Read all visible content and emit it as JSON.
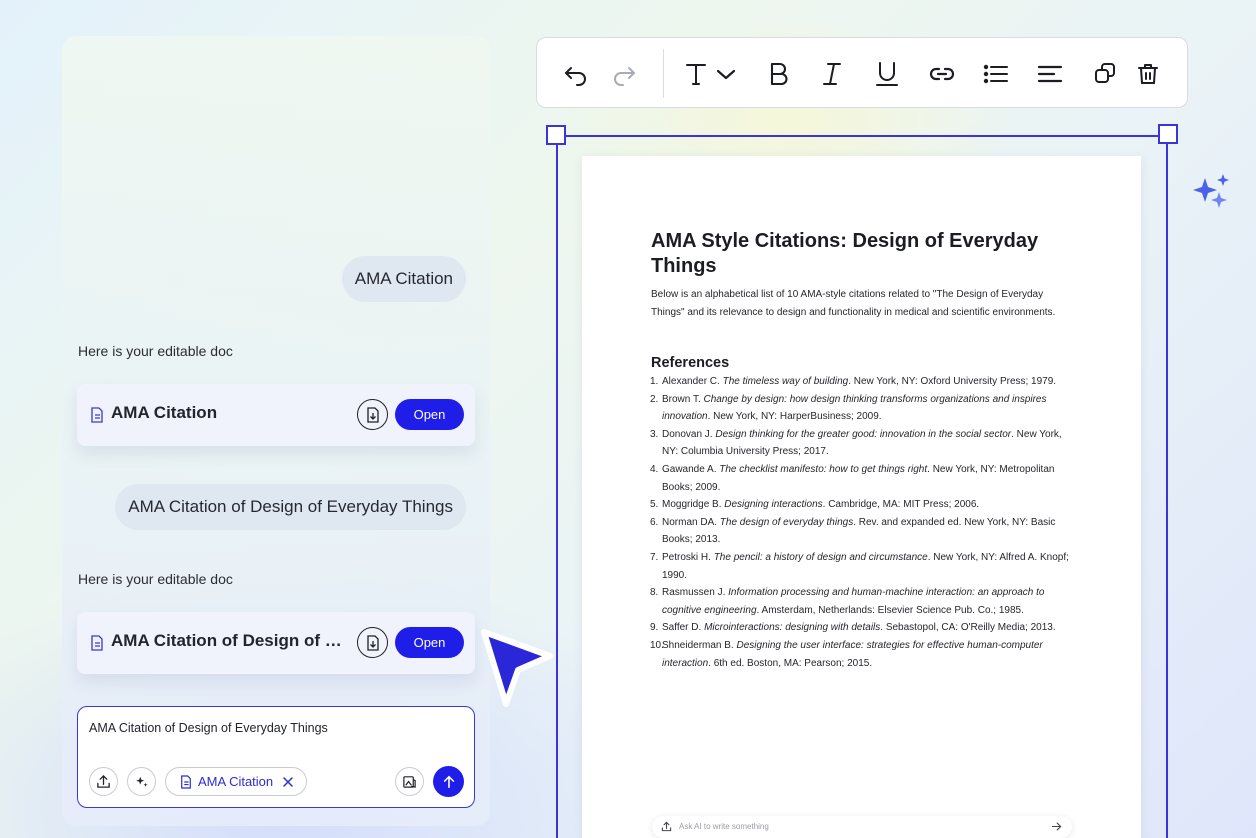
{
  "chat": {
    "user_messages": [
      "AMA Citation",
      "AMA Citation of Design of Everyday Things"
    ],
    "assistant_messages": [
      "Here is your editable doc",
      "Here is your editable doc"
    ],
    "doc_cards": [
      {
        "title": "AMA Citation",
        "open_label": "Open"
      },
      {
        "title": "AMA Citation of Design of Everyday Things",
        "open_label": "Open"
      }
    ],
    "composer": {
      "text": "AMA Citation of Design of Everyday Things",
      "attachment_label": "AMA Citation"
    }
  },
  "toolbar": {
    "icons": [
      "undo-icon",
      "redo-icon",
      "text-style-icon",
      "bold-icon",
      "italic-icon",
      "underline-icon",
      "link-icon",
      "bullet-list-icon",
      "align-icon",
      "duplicate-icon",
      "delete-icon"
    ]
  },
  "document": {
    "title": "AMA Style Citations: Design of Everyday Things",
    "intro": "Below is an alphabetical list of 10 AMA-style citations related to \"The Design of Everyday Things\" and its relevance to design and functionality in medical and scientific environments.",
    "references_heading": "References",
    "references": [
      {
        "num": "1.",
        "author": "Alexander C.",
        "title": "The timeless way of building",
        "rest": ". New York, NY: Oxford University Press; 1979."
      },
      {
        "num": "2.",
        "author": "Brown T.",
        "title": "Change by design: how design thinking transforms organizations and inspires innovation",
        "rest": ". New York, NY: HarperBusiness; 2009."
      },
      {
        "num": "3.",
        "author": "Donovan J.",
        "title": "Design thinking for the greater good: innovation in the social sector",
        "rest": ". New York, NY: Columbia University Press; 2017."
      },
      {
        "num": "4.",
        "author": "Gawande A.",
        "title": "The checklist manifesto: how to get things right",
        "rest": ". New York, NY: Metropolitan Books; 2009."
      },
      {
        "num": "5.",
        "author": "Moggridge B.",
        "title": "Designing interactions",
        "rest": ". Cambridge, MA: MIT Press; 2006."
      },
      {
        "num": "6.",
        "author": "Norman DA.",
        "title": "The design of everyday things",
        "rest": ". Rev. and expanded ed. New York, NY: Basic Books; 2013."
      },
      {
        "num": "7.",
        "author": "Petroski H.",
        "title": "The pencil: a history of design and circumstance",
        "rest": ". New York, NY: Alfred A. Knopf; 1990."
      },
      {
        "num": "8.",
        "author": "Rasmussen J.",
        "title": "Information processing and human-machine interaction: an approach to cognitive engineering",
        "rest": ". Amsterdam, Netherlands: Elsevier Science Pub. Co.; 1985."
      },
      {
        "num": "9.",
        "author": "Saffer D.",
        "title": "Microinteractions: designing with details",
        "rest": ". Sebastopol, CA: O'Reilly Media; 2013."
      },
      {
        "num": "10.",
        "author": "Shneiderman B.",
        "title": "Designing the user interface: strategies for effective human-computer interaction",
        "rest": ". 6th ed. Boston, MA: Pearson; 2015."
      }
    ],
    "ai_placeholder": "Ask AI to write something"
  },
  "colors": {
    "accent": "#1f1de8",
    "frame": "#3a35d9",
    "bubble": "#dfe8f1"
  }
}
